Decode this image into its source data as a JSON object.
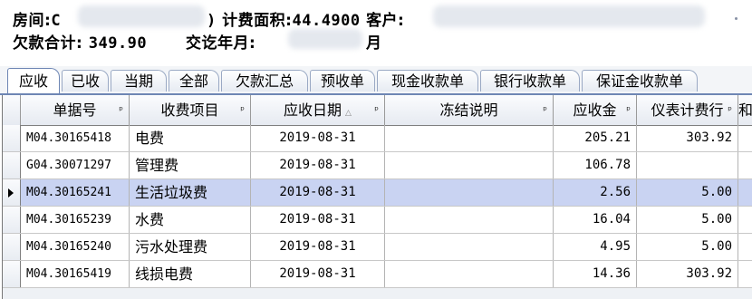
{
  "info": {
    "room_label": "房间:",
    "room_value": "C",
    "area_label": "计费面积:",
    "area_value": "44.4900",
    "customer_label": "客户:",
    "arrears_label": "欠款合计:",
    "arrears_value": "349.90",
    "until_label": "交讫年月:",
    "until_suffix": "月"
  },
  "tabs": [
    "应收",
    "已收",
    "当期",
    "全部",
    "欠款汇总",
    "预收单",
    "现金收款单",
    "银行收款单",
    "保证金收款单"
  ],
  "columns": [
    "单据号",
    "收费项目",
    "应收日期",
    "冻结说明",
    "应收金",
    "仪表计费行",
    "和"
  ],
  "rows": [
    {
      "code": "M04.30165418",
      "item": "电费",
      "date": "2019-08-31",
      "note": "",
      "amount": "205.21",
      "meter": "303.92"
    },
    {
      "code": "G04.30071297",
      "item": "管理费",
      "date": "2019-08-31",
      "note": "",
      "amount": "106.78",
      "meter": ""
    },
    {
      "code": "M04.30165241",
      "item": "生活垃圾费",
      "date": "2019-08-31",
      "note": "",
      "amount": "2.56",
      "meter": "5.00"
    },
    {
      "code": "M04.30165239",
      "item": "水费",
      "date": "2019-08-31",
      "note": "",
      "amount": "16.04",
      "meter": "5.00"
    },
    {
      "code": "M04.30165240",
      "item": "污水处理费",
      "date": "2019-08-31",
      "note": "",
      "amount": "4.95",
      "meter": "5.00"
    },
    {
      "code": "M04.30165419",
      "item": "线损电费",
      "date": "2019-08-31",
      "note": "",
      "amount": "14.36",
      "meter": "303.92"
    }
  ],
  "selected_row": 2
}
